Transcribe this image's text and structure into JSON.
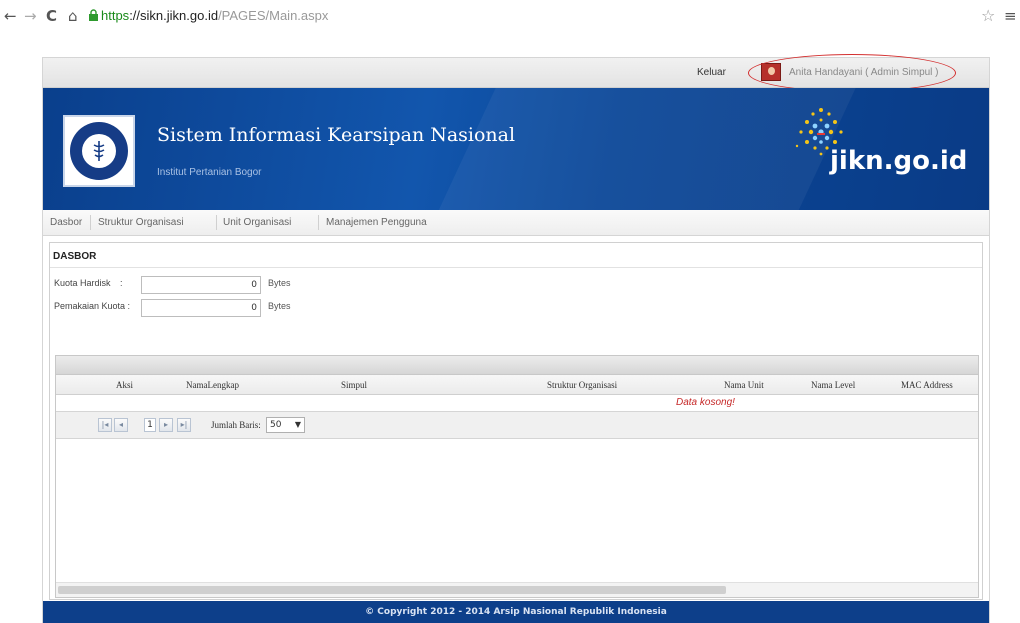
{
  "browser": {
    "url_scheme": "https",
    "url_host": "://sikn.jikn.go.id",
    "url_path": "/PAGES/Main.aspx"
  },
  "topbar": {
    "logout_label": "Keluar",
    "user_label": "Anita Handayani ( Admin Simpul )"
  },
  "banner": {
    "title": "Sistem Informasi Kearsipan Nasional",
    "subtitle": "Institut Pertanian Bogor",
    "brand": "jikn.go.id"
  },
  "menu": {
    "items": [
      {
        "label": "Dasbor"
      },
      {
        "label": "Struktur Organisasi"
      },
      {
        "label": "Unit Organisasi"
      },
      {
        "label": "Manajemen Pengguna"
      }
    ]
  },
  "dashboard": {
    "title": "DASBOR",
    "fields": [
      {
        "label": "Kuota Hardisk",
        "value": "0",
        "unit": "Bytes"
      },
      {
        "label": "Pemakaian Kuota :",
        "value": "0",
        "unit": "Bytes"
      }
    ]
  },
  "grid": {
    "columns": [
      "Aksi",
      "NamaLengkap",
      "Simpul",
      "Struktur Organisasi",
      "Nama Unit",
      "Nama Level",
      "MAC Address"
    ],
    "empty_text": "Data kosong!",
    "pager": {
      "first": "◄◄",
      "prev": "◄",
      "page": "1",
      "next": "►",
      "last": "►►",
      "rows_label": "Jumlah Baris:",
      "rows_value": "50"
    }
  },
  "footer": {
    "text": "© Copyright 2012 - 2014 Arsip Nasional Republik Indonesia"
  },
  "colors": {
    "banner_blue": "#0e4ea0",
    "footer_blue": "#0d3f8a",
    "highlight_red": "#d32f2f",
    "empty_red": "#c62828"
  }
}
